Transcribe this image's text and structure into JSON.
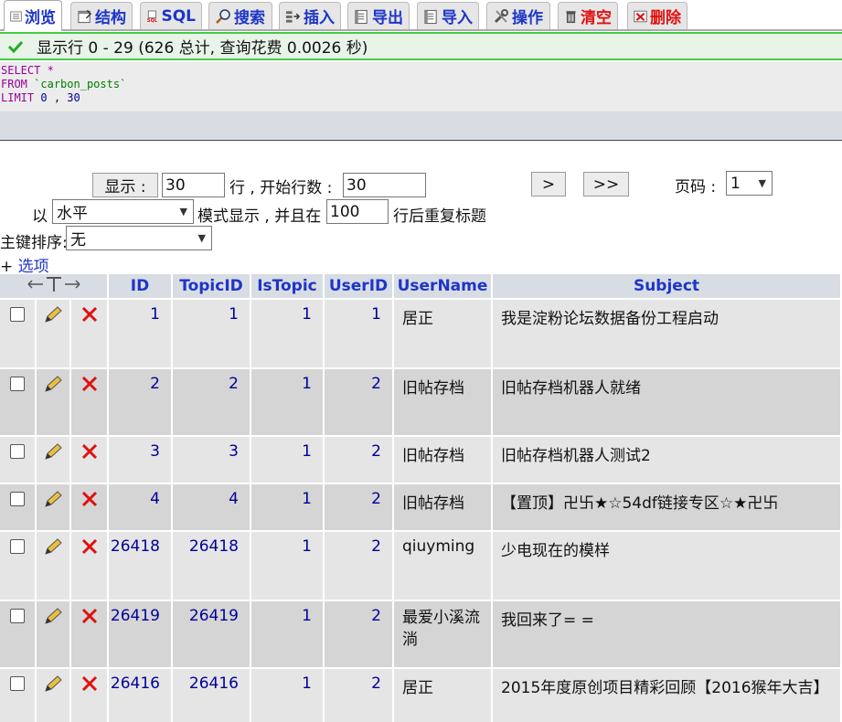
{
  "tabs": [
    {
      "label": "浏览",
      "icon": "browse-icon",
      "active": true
    },
    {
      "label": "结构",
      "icon": "structure-icon"
    },
    {
      "label": "SQL",
      "icon": "sql-icon"
    },
    {
      "label": "搜索",
      "icon": "search-icon"
    },
    {
      "label": "插入",
      "icon": "insert-icon"
    },
    {
      "label": "导出",
      "icon": "export-icon"
    },
    {
      "label": "导入",
      "icon": "import-icon"
    },
    {
      "label": "操作",
      "icon": "operations-icon"
    },
    {
      "label": "清空",
      "icon": "empty-icon",
      "danger": true
    },
    {
      "label": "删除",
      "icon": "drop-icon",
      "danger": true
    }
  ],
  "notice": {
    "text": "显示行 0 - 29 (626 总计, 查询花费 0.0026 秒)",
    "color": "#44cc44"
  },
  "sql": {
    "kw_select": "SELECT",
    "star": "*",
    "kw_from": "FROM",
    "table": "`carbon_posts`",
    "kw_limit": "LIMIT",
    "offset": "0",
    "comma": ",",
    "count": "30"
  },
  "nav": {
    "show_button": "显示 :",
    "rows_value": "30",
    "rows_label": "行 , 开始行数 :",
    "start_value": "30",
    "next_button": ">",
    "last_button": ">>",
    "page_label": "页码 :",
    "page_value": "1",
    "mode_prefix": "以",
    "mode_value": "水平",
    "mode_label": "模式显示 , 并且在",
    "repeat_value": "100",
    "repeat_label": "行后重复标题",
    "sort_label": "主键排序:",
    "sort_value": "无",
    "options_plus": "+",
    "options_link": "选项"
  },
  "table": {
    "columns": [
      "ID",
      "TopicID",
      "IsTopic",
      "UserID",
      "UserName",
      "Subject"
    ],
    "rows": [
      {
        "id": "1",
        "topic": "1",
        "istopic": "1",
        "user": "1",
        "name": "居正",
        "subject": "我是淀粉论坛数据备份工程启动"
      },
      {
        "id": "2",
        "topic": "2",
        "istopic": "1",
        "user": "2",
        "name": "旧帖存档",
        "subject": "旧帖存档机器人就绪"
      },
      {
        "id": "3",
        "topic": "3",
        "istopic": "1",
        "user": "2",
        "name": "旧帖存档",
        "subject": "旧帖存档机器人测试2"
      },
      {
        "id": "4",
        "topic": "4",
        "istopic": "1",
        "user": "2",
        "name": "旧帖存档",
        "subject": "【置顶】卍卐★☆54df链接专区☆★卍卐"
      },
      {
        "id": "26418",
        "topic": "26418",
        "istopic": "1",
        "user": "2",
        "name": "qiuyming",
        "subject": "少电现在的模样"
      },
      {
        "id": "26419",
        "topic": "26419",
        "istopic": "1",
        "user": "2",
        "name": "最爱小溪流淌",
        "subject": "我回来了= ="
      },
      {
        "id": "26416",
        "topic": "26416",
        "istopic": "1",
        "user": "2",
        "name": "居正",
        "subject": "2015年度原创项目精彩回顾【2016猴年大吉】"
      }
    ]
  }
}
